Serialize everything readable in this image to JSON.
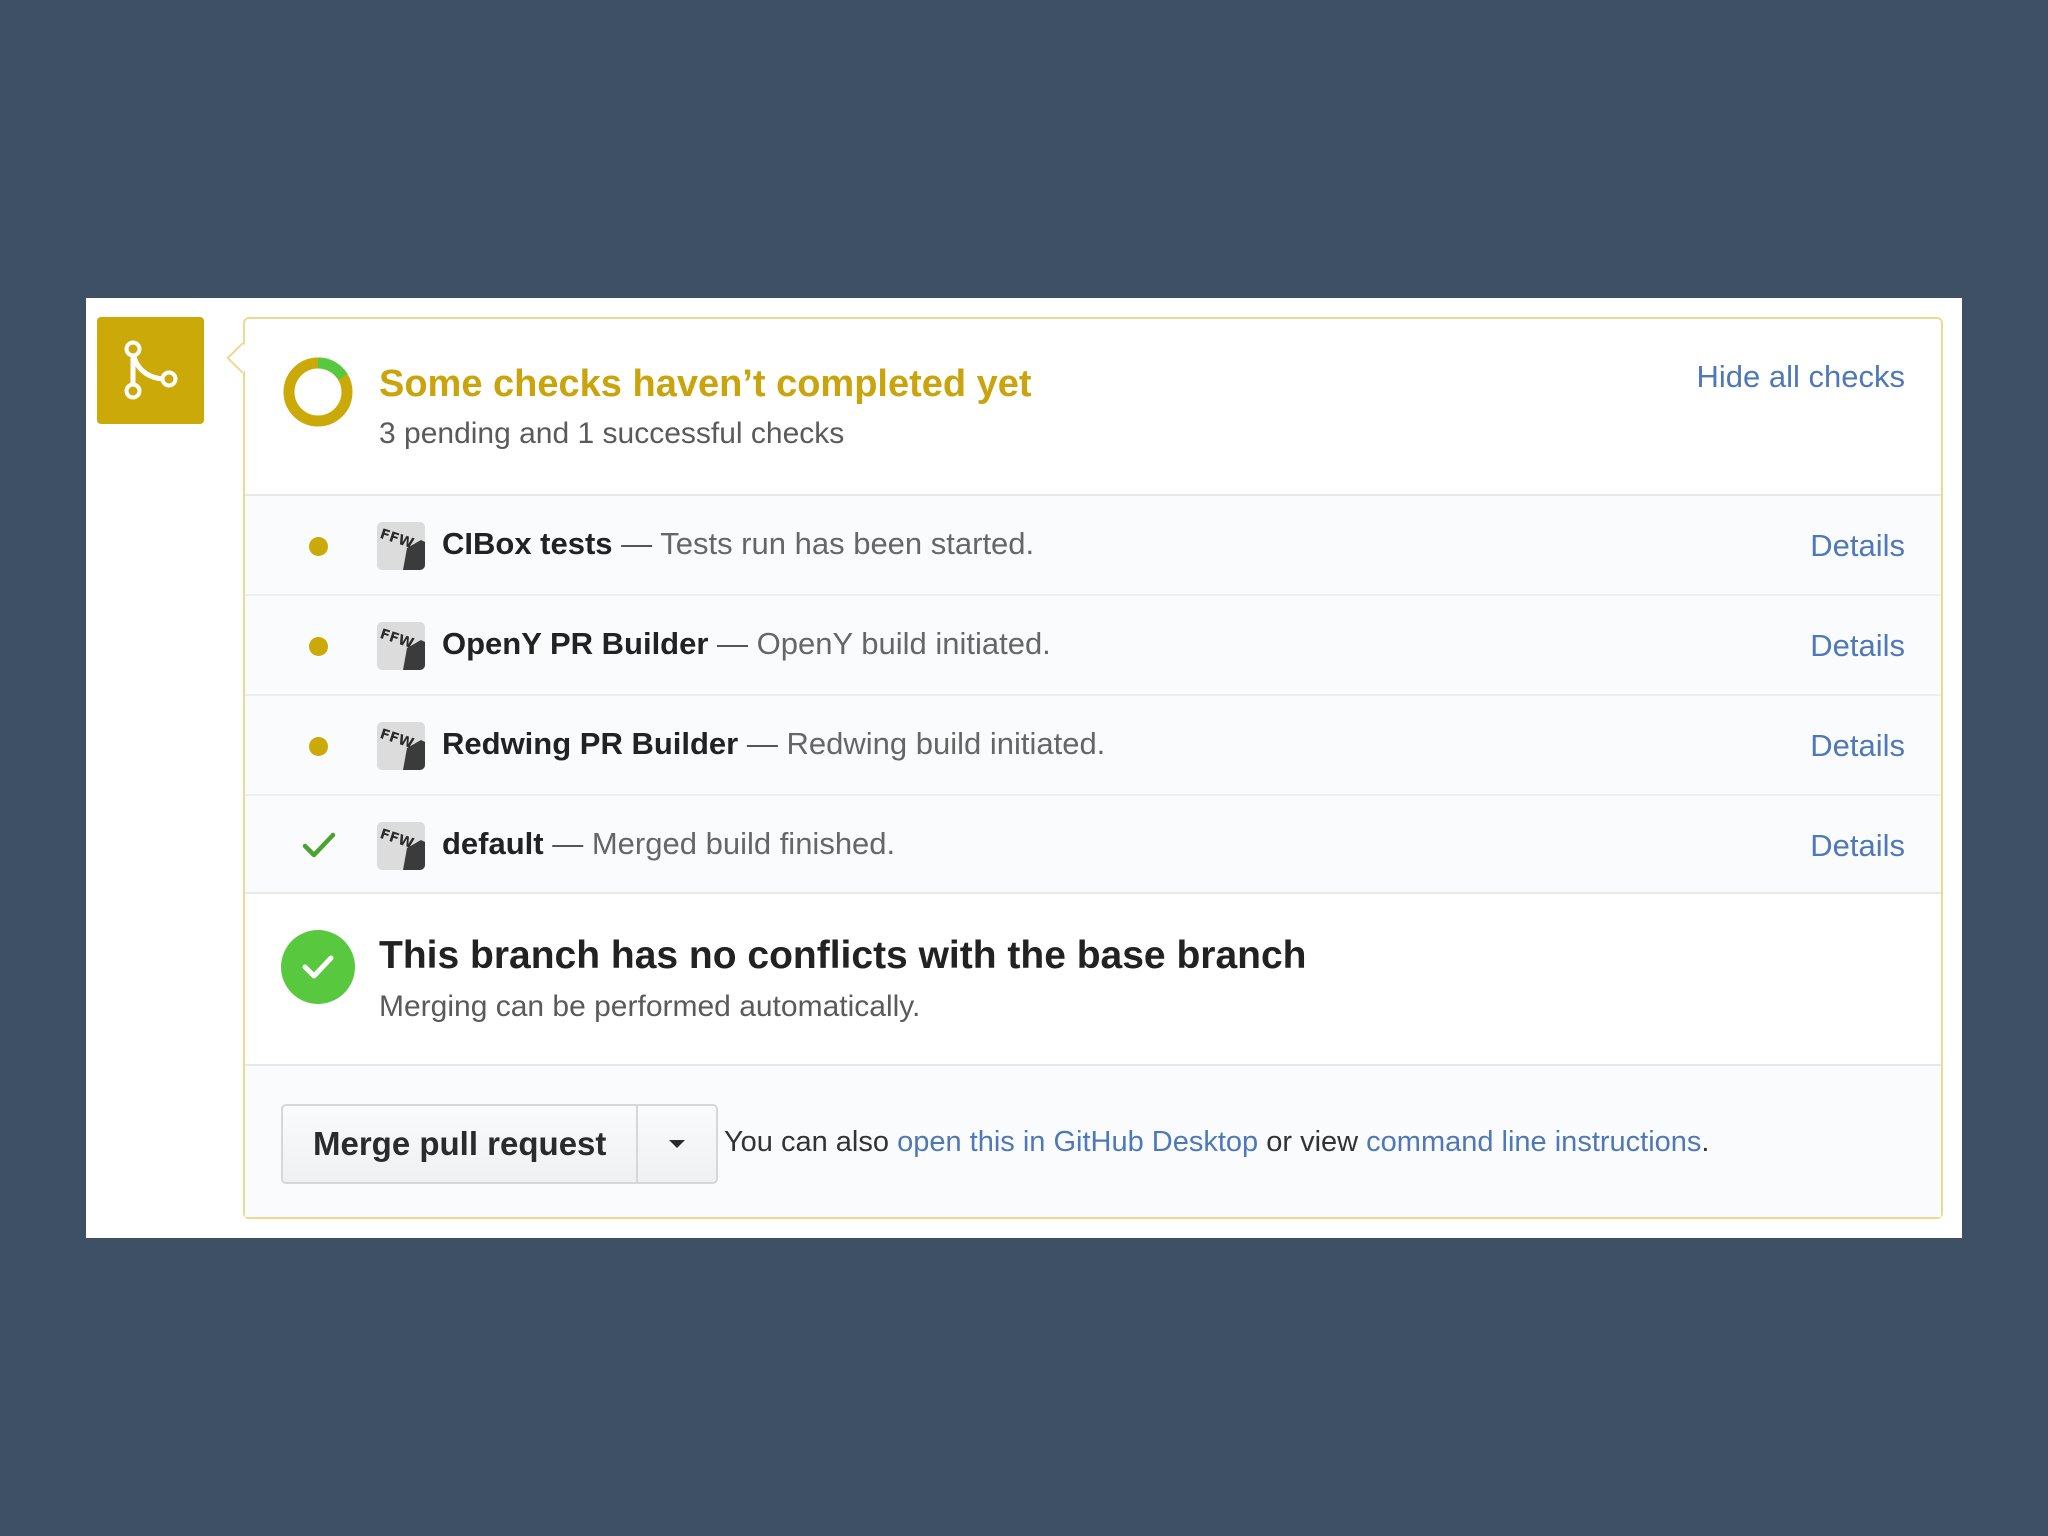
{
  "status": {
    "title": "Some checks haven’t completed yet",
    "subtitle": "3 pending and 1 successful checks",
    "hide_link": "Hide all checks"
  },
  "checks": [
    {
      "name": "CIBox tests",
      "separator": " — ",
      "description": "Tests run has been started.",
      "state": "pending",
      "details": "Details"
    },
    {
      "name": "OpenY PR Builder",
      "separator": " — ",
      "description": "OpenY build initiated.",
      "state": "pending",
      "details": "Details"
    },
    {
      "name": "Redwing PR Builder",
      "separator": " — ",
      "description": "Redwing build initiated.",
      "state": "pending",
      "details": "Details"
    },
    {
      "name": "default",
      "separator": " — ",
      "description": "Merged build finished.",
      "state": "success",
      "details": "Details"
    }
  ],
  "conflict": {
    "title": "This branch has no conflicts with the base branch",
    "subtitle": "Merging can be performed automatically."
  },
  "merge": {
    "button_label": "Merge pull request",
    "info_prefix": "You can also ",
    "desktop_link": "open this in GitHub Desktop",
    "info_middle": " or view ",
    "cli_link": "command line instructions",
    "info_suffix": "."
  },
  "icons": {
    "badge": "git-merge-icon",
    "status": "pending-ring-icon",
    "conflict": "check-circle-icon",
    "dropdown": "caret-down-icon",
    "avatar": "ffw-avatar"
  },
  "colors": {
    "background": "#3d5066",
    "pending": "#cba908",
    "success": "#58c83f",
    "link": "#4f78b8",
    "card_border": "#efd990"
  }
}
